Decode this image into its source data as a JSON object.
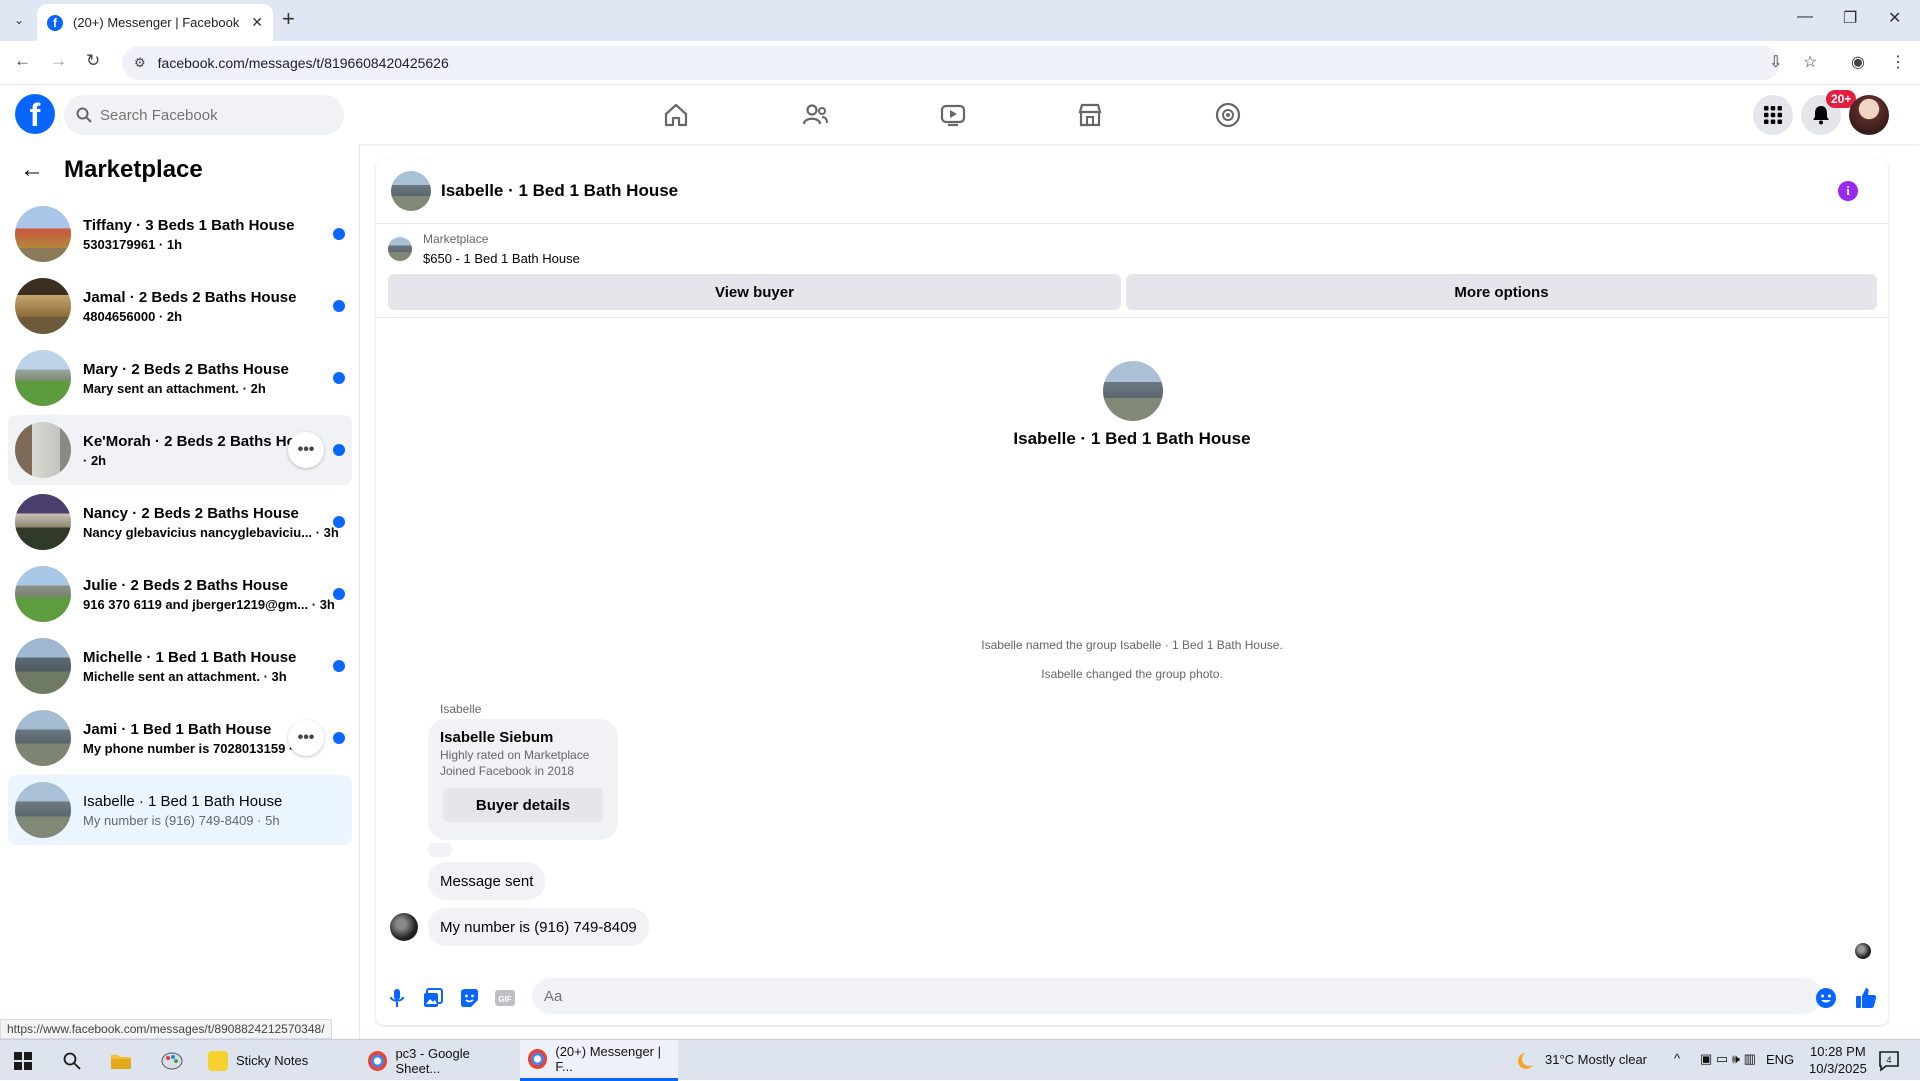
{
  "browser": {
    "tab_title": "(20+) Messenger | Facebook",
    "url": "facebook.com/messages/t/8196608420425626",
    "status_url": "https://www.facebook.com/messages/t/8908824212570348/"
  },
  "header": {
    "search_placeholder": "Search Facebook",
    "notification_badge": "20+"
  },
  "sidebar": {
    "title": "Marketplace",
    "conversations": [
      {
        "name": "Tiffany · 3 Beds 1 Bath House",
        "preview": "5303179961 · 1h",
        "unread": true
      },
      {
        "name": "Jamal · 2 Beds 2 Baths House",
        "preview": "4804656000 · 2h",
        "unread": true
      },
      {
        "name": "Mary · 2 Beds 2 Baths House",
        "preview": "Mary sent an attachment. · 2h",
        "unread": true
      },
      {
        "name": "Ke'Morah · 2 Beds 2 Baths House",
        "preview": " · 2h",
        "unread": true
      },
      {
        "name": "Nancy · 2 Beds 2 Baths House",
        "preview": "Nancy glebavicius nancyglebaviciu... · 3h",
        "unread": true
      },
      {
        "name": "Julie · 2 Beds 2 Baths House",
        "preview": "916 370 6119 and jberger1219@gm... · 3h",
        "unread": true
      },
      {
        "name": "Michelle · 1 Bed 1 Bath House",
        "preview": "Michelle sent an attachment. · 3h",
        "unread": true
      },
      {
        "name": "Jami · 1 Bed 1 Bath House",
        "preview": "My phone number is 7028013159 · 5h",
        "unread": true
      },
      {
        "name": "Isabelle · 1 Bed 1 Bath House",
        "preview": "My number is (916) 749-8409 · 5h",
        "unread": false
      }
    ]
  },
  "chat": {
    "title": "Isabelle · 1 Bed 1 Bath House",
    "marketplace_label": "Marketplace",
    "listing": "$650 - 1 Bed 1 Bath House",
    "view_buyer": "View buyer",
    "more_options": "More options",
    "center_name": "Isabelle · 1 Bed 1 Bath House",
    "system_messages": [
      "Isabelle named the group Isabelle · 1 Bed 1 Bath House.",
      "Isabelle changed the group photo."
    ],
    "sender": "Isabelle",
    "card": {
      "name": "Isabelle Siebum",
      "line1": "Highly rated on Marketplace",
      "line2": "Joined Facebook in 2018",
      "button": "Buyer details"
    },
    "message_sent": "Message sent",
    "last_message": "My number is (916) 749-8409",
    "composer_placeholder": "Aa"
  },
  "taskbar": {
    "apps": [
      "Sticky Notes",
      "pc3 - Google Sheet...",
      "(20+) Messenger | F..."
    ],
    "weather": "31°C  Mostly clear",
    "lang": "ENG",
    "time": "10:28 PM",
    "date": "10/3/2025",
    "notif_count": "4"
  },
  "colors": {
    "accent": "#0866ff",
    "unread_dot": "#0866ff",
    "info": "#9b28f0",
    "badge": "#e41e3f"
  }
}
